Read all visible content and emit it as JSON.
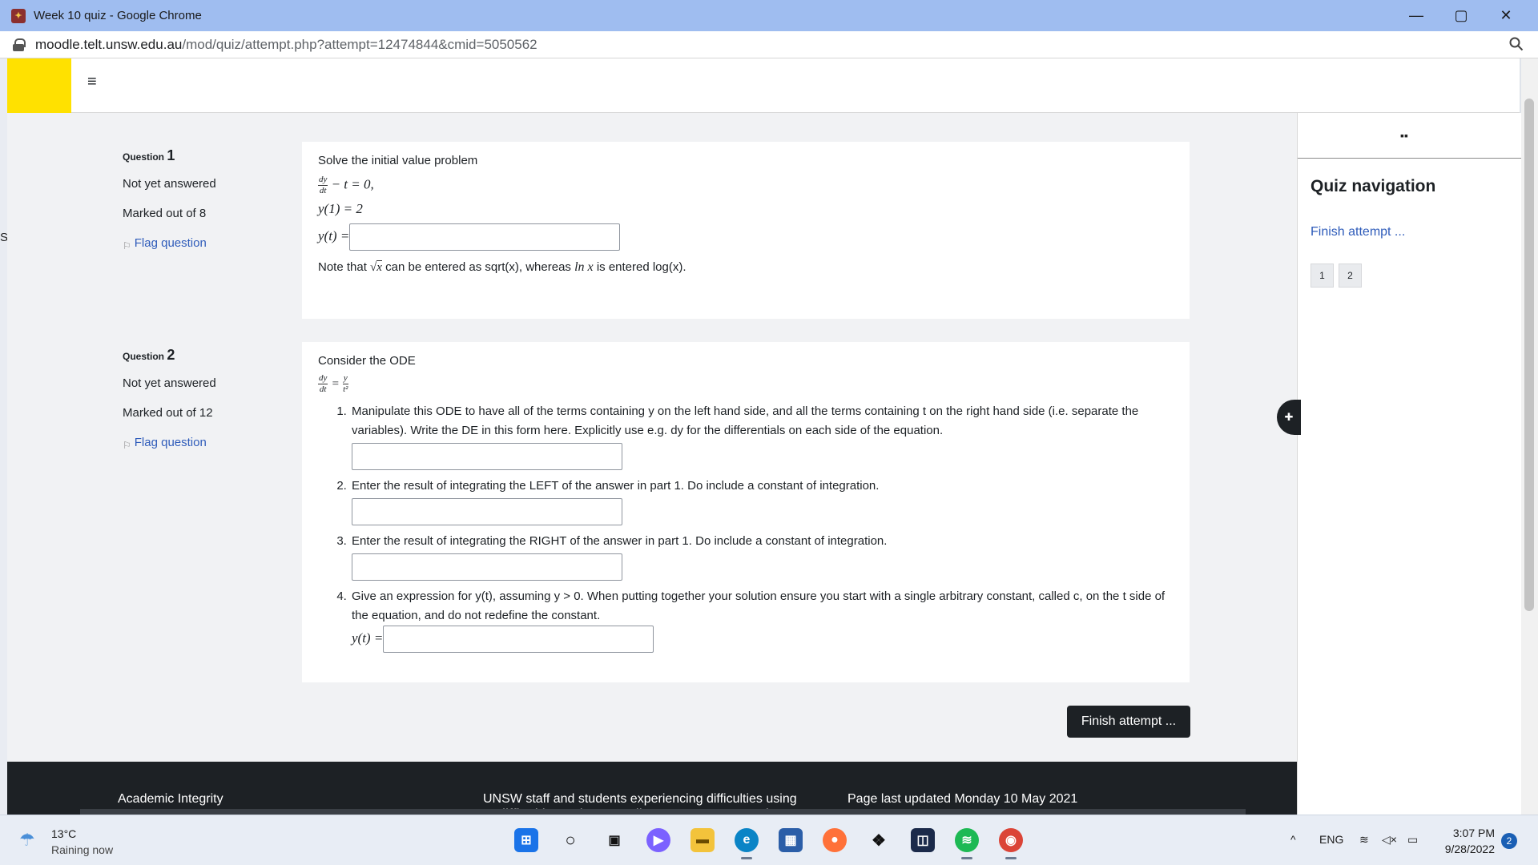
{
  "window": {
    "title": "Week 10 quiz - Google Chrome",
    "minimize": "—",
    "maximize": "▢",
    "close": "✕"
  },
  "address": {
    "host": "moodle.telt.unsw.edu.au",
    "path": "/mod/quiz/attempt.php?attempt=12474844&cmid=5050562"
  },
  "nav": {
    "hamburger": "≡"
  },
  "questions": [
    {
      "label": "Question",
      "number": "1",
      "status": "Not yet answered",
      "marks": "Marked out of 8",
      "flag": "Flag question",
      "intro": "Solve the initial value problem",
      "eq1_rest": "− t = 0,",
      "eq2": "y(1) = 2",
      "answer_label": "y(t) =",
      "note_pre": "Note that",
      "note_sqrt": "x",
      "note_mid": "can be entered as sqrt(x), whereas",
      "note_ln": "ln x",
      "note_post": "is entered log(x)."
    },
    {
      "label": "Question",
      "number": "2",
      "status": "Not yet answered",
      "marks": "Marked out of 12",
      "flag": "Flag question",
      "intro": "Consider the ODE",
      "parts": [
        "Manipulate this ODE to have all of the terms containing y on the left hand side, and all the terms containing t on the right hand side (i.e. separate the variables).  Write the DE in this form here.  Explicitly use e.g. dy for the differentials on each side of the equation.",
        "Enter the result of integrating the LEFT of the answer in part 1.  Do include a constant of integration.",
        "Enter the result of integrating the RIGHT of the answer in part 1.  Do include a constant of integration.",
        "Give an expression for y(t), assuming y > 0.  When putting together your solution ensure you start with a single arbitrary constant, called c, on the t side of the equation, and do not redefine the constant."
      ],
      "answer_label": "y(t) ="
    }
  ],
  "finish_button": "Finish attempt ...",
  "drawer": {
    "heading": "Quiz navigation",
    "finish_link": "Finish attempt ...",
    "question_buttons": [
      "1",
      "2"
    ]
  },
  "footer": {
    "academic": "Academic Integrity",
    "staff": "UNSW staff and students experiencing difficulties using",
    "clipped": "difficulties using Moodle? Contact External",
    "updated": "Page last updated Monday 10 May 2021"
  },
  "taskbar": {
    "temperature": "13°C",
    "condition": "Raining now",
    "language": "ENG",
    "time": "3:07 PM",
    "date": "9/28/2022",
    "notifications": "2"
  },
  "colors": {
    "brand_yellow": "#ffe100",
    "link_blue": "#2f5cba",
    "dark": "#1d2125"
  }
}
